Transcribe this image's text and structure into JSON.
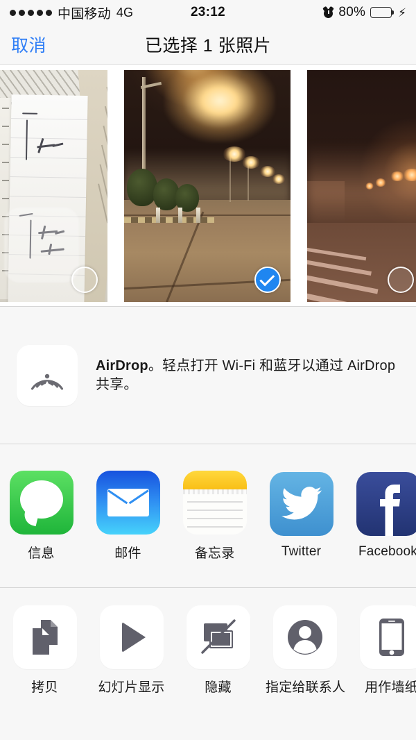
{
  "status_bar": {
    "signal_dots": 5,
    "carrier": "中国移动",
    "network": "4G",
    "time": "23:12",
    "alarm_icon": "alarm-clock-icon",
    "battery_percent": "80%",
    "battery_level": 80,
    "charging": true,
    "battery_color": "#4cd264"
  },
  "nav": {
    "cancel_label": "取消",
    "title": "已选择 1 张照片",
    "tint_color": "#2f7ef6"
  },
  "photos": [
    {
      "name": "handwritten-note-photo",
      "selected": false,
      "description": "手写笔记纸张"
    },
    {
      "name": "foggy-street-night-photo",
      "selected": true,
      "description": "雾夜路灯街道"
    },
    {
      "name": "foggy-crosswalk-night-photo",
      "selected": false,
      "description": "雾夜斑马线"
    }
  ],
  "selection": {
    "selected_count": 1,
    "checkmark_color": "#1f86f0"
  },
  "airdrop": {
    "icon": "airdrop-icon",
    "title": "AirDrop",
    "message_prefix": "AirDrop",
    "message_rest": "。轻点打开 Wi-Fi 和蓝牙以通过 AirDrop 共享。"
  },
  "apps": [
    {
      "label": "信息",
      "icon": "messages-icon",
      "color": "#3ecb55"
    },
    {
      "label": "邮件",
      "icon": "mail-icon",
      "color": "#2f8ff2"
    },
    {
      "label": "备忘录",
      "icon": "notes-icon",
      "color": "#ffd83d"
    },
    {
      "label": "Twitter",
      "icon": "twitter-icon",
      "color": "#4fa3d8"
    },
    {
      "label": "Facebook",
      "icon": "facebook-icon",
      "color": "#2c3f86"
    },
    {
      "label": "",
      "icon": "flickr-icon",
      "color": "#f7c32b"
    }
  ],
  "actions": [
    {
      "label": "拷贝",
      "icon": "copy-icon"
    },
    {
      "label": "幻灯片显示",
      "icon": "slideshow-play-icon"
    },
    {
      "label": "隐藏",
      "icon": "hide-photo-icon"
    },
    {
      "label": "指定给联系人",
      "icon": "assign-to-contact-icon"
    },
    {
      "label": "用作墙纸",
      "icon": "use-as-wallpaper-icon"
    }
  ]
}
